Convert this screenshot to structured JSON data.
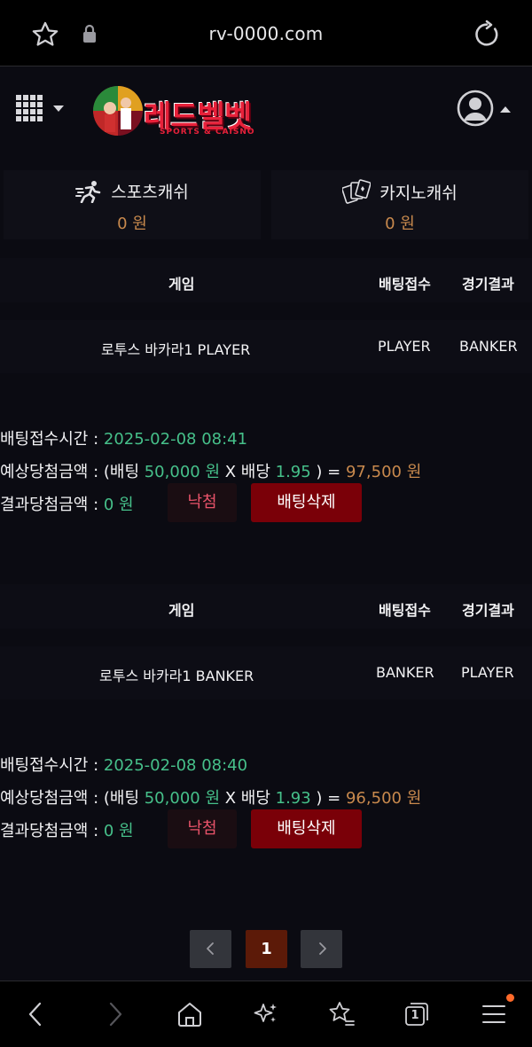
{
  "browser": {
    "url": "rv-0000.com",
    "tab_count": "1",
    "icons": [
      "star-icon",
      "lock-icon",
      "reload-icon",
      "back-icon",
      "forward-icon",
      "home-icon",
      "sparkle-icon",
      "bookmark-star-icon",
      "tabs-icon",
      "menu-icon"
    ],
    "notification_color": "#ff6a2a"
  },
  "header": {
    "logo_text": "레드벨벳",
    "logo_subtitle": "SPORTS & CAISNO"
  },
  "cash": {
    "sports_label": "스포츠캐쉬",
    "sports_amount": "0 원",
    "casino_label": "카지노캐쉬",
    "casino_amount": "0 원"
  },
  "table_headers": {
    "game": "게임",
    "bet_pick": "배팅접수",
    "result": "경기결과"
  },
  "labels": {
    "bet_time": "배팅접수시간 : ",
    "expected_prefix": "예상당첨금액 : (배팅 ",
    "x_odds": " X 배당 ",
    "close_eq": " ) = ",
    "result_amount": "결과당첨금액 : ",
    "loss_button": "낙첨",
    "delete_button": "배팅삭제"
  },
  "bets": [
    {
      "game": "로투스 바카라1 PLAYER",
      "pick": "PLAYER",
      "result": "BANKER",
      "time": "2025-02-08 08:41",
      "stake": "50,000 원",
      "odds": "1.95",
      "expected": "97,500 원",
      "result_amount": "0 원"
    },
    {
      "game": "로투스 바카라1 BANKER",
      "pick": "BANKER",
      "result": "PLAYER",
      "time": "2025-02-08 08:40",
      "stake": "50,000 원",
      "odds": "1.93",
      "expected": "96,500 원",
      "result_amount": "0 원"
    }
  ],
  "pagination": {
    "current": "1",
    "prev": "‹",
    "next": "›"
  },
  "colors": {
    "accent_green": "#46c08a",
    "accent_orange": "#c8894d",
    "delete_red": "#7a0008",
    "loss_pink": "#e9536a",
    "logo_red": "#e8213a"
  }
}
